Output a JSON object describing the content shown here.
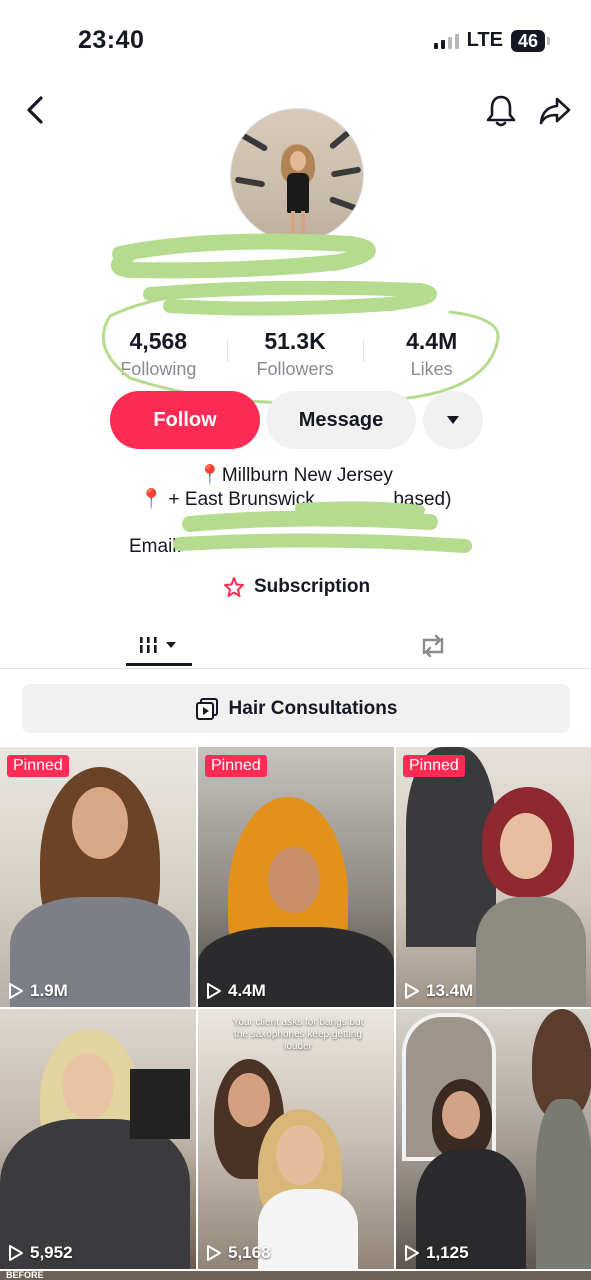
{
  "status_bar": {
    "time": "23:40",
    "network": "LTE",
    "battery": "46"
  },
  "header": {
    "back_icon": "chevron-left-icon",
    "bell_icon": "bell-icon",
    "share_icon": "share-arrow-icon"
  },
  "stats": [
    {
      "value": "4,568",
      "label": "Following"
    },
    {
      "value": "51.3K",
      "label": "Followers"
    },
    {
      "value": "4.4M",
      "label": "Likes"
    }
  ],
  "actions": {
    "follow": "Follow",
    "message": "Message"
  },
  "bio": {
    "line1": "Millburn New Jersey",
    "line2_prefix": "+ East Brunswick",
    "line2_suffix": "based)",
    "line3": "Email:"
  },
  "subscription": {
    "label": "Subscription"
  },
  "playlist": {
    "label": "Hair Consultations"
  },
  "colors": {
    "accent": "#fe2c55",
    "censor_scribble": "#b5dc8e"
  },
  "videos": [
    {
      "pinned": "Pinned",
      "views": "1.9M",
      "caption": ""
    },
    {
      "pinned": "Pinned",
      "views": "4.4M",
      "caption": ""
    },
    {
      "pinned": "Pinned",
      "views": "13.4M",
      "caption": ""
    },
    {
      "pinned": "",
      "views": "5,952",
      "caption": ""
    },
    {
      "pinned": "",
      "views": "5,168",
      "caption": "Your client asks for bangs but the saxophones keep getting louder"
    },
    {
      "pinned": "",
      "views": "1,125",
      "caption": ""
    }
  ],
  "bottom_row": {
    "label": "BEFORE"
  }
}
